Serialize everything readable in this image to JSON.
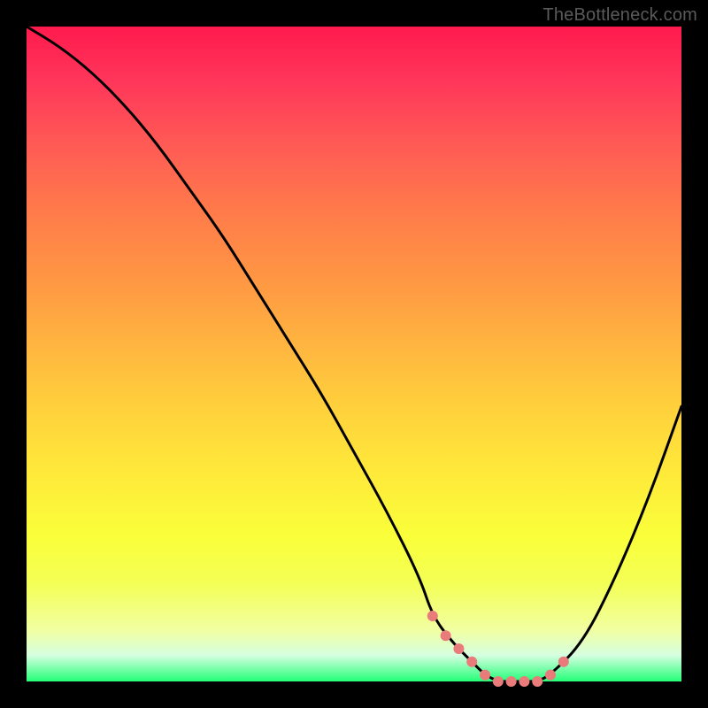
{
  "watermark": "TheBottleneck.com",
  "chart_data": {
    "type": "line",
    "title": "",
    "xlabel": "",
    "ylabel": "",
    "xlim": [
      0,
      100
    ],
    "ylim": [
      0,
      100
    ],
    "series": [
      {
        "name": "bottleneck-curve",
        "x": [
          0,
          5,
          10,
          15,
          20,
          25,
          30,
          35,
          40,
          45,
          50,
          55,
          60,
          62,
          65,
          68,
          70,
          72,
          75,
          78,
          80,
          85,
          90,
          95,
          100
        ],
        "values": [
          100,
          97,
          93,
          88,
          82,
          75,
          68,
          60,
          52,
          44,
          35,
          26,
          16,
          10,
          6,
          3,
          1,
          0,
          0,
          0,
          1,
          6,
          16,
          28,
          42
        ]
      }
    ],
    "markers": {
      "name": "highlight-dots",
      "color": "#e97b7b",
      "x": [
        62,
        64,
        66,
        68,
        70,
        72,
        74,
        76,
        78,
        80,
        82
      ],
      "values": [
        10,
        7,
        5,
        3,
        1,
        0,
        0,
        0,
        0,
        1,
        3
      ]
    }
  },
  "colors": {
    "curve": "#000000",
    "marker": "#e97b7b",
    "frame": "#000000"
  }
}
